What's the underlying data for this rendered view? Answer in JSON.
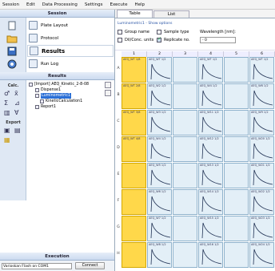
{
  "menu": [
    "Session",
    "Edit",
    "Data Processing",
    "Settings",
    "Execute",
    "Help"
  ],
  "session": {
    "title": "Session",
    "items": [
      {
        "label": "Plate Layout",
        "icon": "plate-layout-icon",
        "selected": false
      },
      {
        "label": "Protocol",
        "icon": "protocol-icon",
        "selected": false
      },
      {
        "label": "Results",
        "icon": "results-icon",
        "selected": true
      },
      {
        "label": "Run Log",
        "icon": "run-log-icon",
        "selected": false
      }
    ]
  },
  "results": {
    "title": "Results",
    "rail_calc": "Calc.",
    "rail_export": "Export",
    "tree": [
      "[Import] AEQ_Kinetic_2-8-08",
      "Dispense1",
      "Luminometric1",
      "KineticCalculation1",
      "Report1"
    ]
  },
  "execution": {
    "title": "Execution",
    "port": "Varioskan Flash on COM1",
    "connect": "Connect"
  },
  "tabs": [
    "Table",
    "List"
  ],
  "filter": {
    "title": "Luminometric1 - Show options",
    "group_name": "Group name",
    "sample_type": "Sample type",
    "wavelength": "Wavelength [nm]:",
    "dil_conc": "Dil/Conc. units",
    "replicate": "Replicate no.",
    "wl_value": "- 0"
  },
  "grid": {
    "columns": [
      "1",
      "2",
      "3",
      "4",
      "5",
      "6"
    ],
    "rows": [
      "A",
      "B",
      "C",
      "D",
      "E",
      "F",
      "G",
      "H"
    ],
    "labels": [
      [
        "AEQ_WT 1/8",
        "AEQ_WT 1/2",
        "",
        "AEQ_WT 1/2",
        "",
        "AEQ_WT 1/2"
      ],
      [
        "AEQ_WT 2/8",
        "AEQ_W2 1/2",
        "",
        "AEQ_W4 1/2",
        "",
        "AEQ_W6 1/2"
      ],
      [
        "AEQ_WT 3/8",
        "AEQ_W3 1/2",
        "",
        "AEQ_W11 1/2",
        "",
        "AEQ_W9 1/2"
      ],
      [
        "AEQ_WT 4/8",
        "AEQ_W4 1/2",
        "",
        "AEQ_W12 1/2",
        "",
        "AEQ_W20 1/2"
      ],
      [
        "",
        "AEQ_W5 1/2",
        "",
        "AEQ_W13 1/2",
        "",
        "AEQ_W21 1/2"
      ],
      [
        "",
        "AEQ_W6 1/2",
        "",
        "AEQ_W14 1/2",
        "",
        "AEQ_W22 1/2"
      ],
      [
        "",
        "AEQ_W7 1/2",
        "",
        "AEQ_W15 1/2",
        "",
        "AEQ_W23 1/2"
      ],
      [
        "",
        "AEQ_W8 1/2",
        "",
        "AEQ_W16 1/2",
        "",
        "AEQ_W24 1/2"
      ]
    ]
  },
  "colors": {
    "highlight": "#ffd84a",
    "cell": "#e3eff7",
    "curve": "#223355"
  }
}
